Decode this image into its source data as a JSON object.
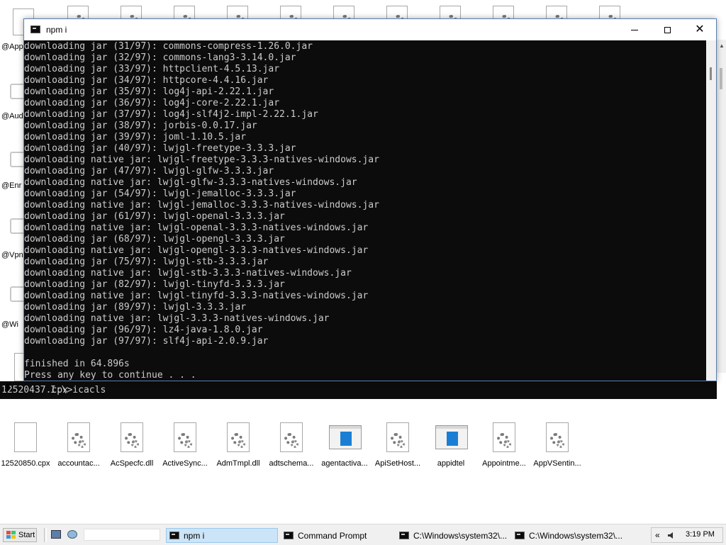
{
  "console": {
    "title": "npm i",
    "lines": [
      "downloading jar (31/97): commons-compress-1.26.0.jar",
      "downloading jar (32/97): commons-lang3-3.14.0.jar",
      "downloading jar (33/97): httpclient-4.5.13.jar",
      "downloading jar (34/97): httpcore-4.4.16.jar",
      "downloading jar (35/97): log4j-api-2.22.1.jar",
      "downloading jar (36/97): log4j-core-2.22.1.jar",
      "downloading jar (37/97): log4j-slf4j2-impl-2.22.1.jar",
      "downloading jar (38/97): jorbis-0.0.17.jar",
      "downloading jar (39/97): joml-1.10.5.jar",
      "downloading jar (40/97): lwjgl-freetype-3.3.3.jar",
      "downloading native jar: lwjgl-freetype-3.3.3-natives-windows.jar",
      "downloading jar (47/97): lwjgl-glfw-3.3.3.jar",
      "downloading native jar: lwjgl-glfw-3.3.3-natives-windows.jar",
      "downloading jar (54/97): lwjgl-jemalloc-3.3.3.jar",
      "downloading native jar: lwjgl-jemalloc-3.3.3-natives-windows.jar",
      "downloading jar (61/97): lwjgl-openal-3.3.3.jar",
      "downloading native jar: lwjgl-openal-3.3.3-natives-windows.jar",
      "downloading jar (68/97): lwjgl-opengl-3.3.3.jar",
      "downloading native jar: lwjgl-opengl-3.3.3-natives-windows.jar",
      "downloading jar (75/97): lwjgl-stb-3.3.3.jar",
      "downloading native jar: lwjgl-stb-3.3.3-natives-windows.jar",
      "downloading jar (82/97): lwjgl-tinyfd-3.3.3.jar",
      "downloading native jar: lwjgl-tinyfd-3.3.3-natives-windows.jar",
      "downloading jar (89/97): lwjgl-3.3.3.jar",
      "downloading native jar: lwjgl-3.3.3-natives-windows.jar",
      "downloading jar (96/97): lz4-java-1.8.0.jar",
      "downloading jar (97/97): slf4j-api-2.0.9.jar",
      "",
      "finished in 64.896s",
      "Press any key to continue . . ."
    ]
  },
  "back_console": {
    "prompt": "I:\\>icacls",
    "partial_label": "12520437.cpx"
  },
  "left_labels": [
    "@App",
    "@Aud",
    "@Enr",
    "@Vpn",
    "@Wi"
  ],
  "desktop_icons": [
    {
      "label": "12520850.cpx",
      "icon": "blank-document-icon"
    },
    {
      "label": "accountac...",
      "icon": "gear-document-icon"
    },
    {
      "label": "AcSpecfc.dll",
      "icon": "gear-document-icon"
    },
    {
      "label": "ActiveSync...",
      "icon": "gear-document-icon"
    },
    {
      "label": "AdmTmpl.dll",
      "icon": "gear-document-icon"
    },
    {
      "label": "adtschema...",
      "icon": "gear-document-icon"
    },
    {
      "label": "agentactiva...",
      "icon": "window-app-icon"
    },
    {
      "label": "ApiSetHost...",
      "icon": "gear-document-icon"
    },
    {
      "label": "appidtel",
      "icon": "window-app-icon"
    },
    {
      "label": "Appointme...",
      "icon": "gear-document-icon"
    },
    {
      "label": "AppVSentin...",
      "icon": "gear-document-icon"
    }
  ],
  "taskbar": {
    "start_label": "Start",
    "tasks": [
      {
        "label": "npm i",
        "active": true
      },
      {
        "label": "Command Prompt",
        "active": false
      },
      {
        "label": "C:\\Windows\\system32\\...",
        "active": false
      },
      {
        "label": "C:\\Windows\\system32\\...",
        "active": false
      }
    ],
    "clock": "3:19 PM",
    "tray_chevron": "«"
  },
  "colors": {
    "console_bg": "#0c0c0c",
    "console_text": "#cccccc",
    "active_task_bg": "#cce4f7",
    "accent_blue": "#1a7fd4"
  }
}
